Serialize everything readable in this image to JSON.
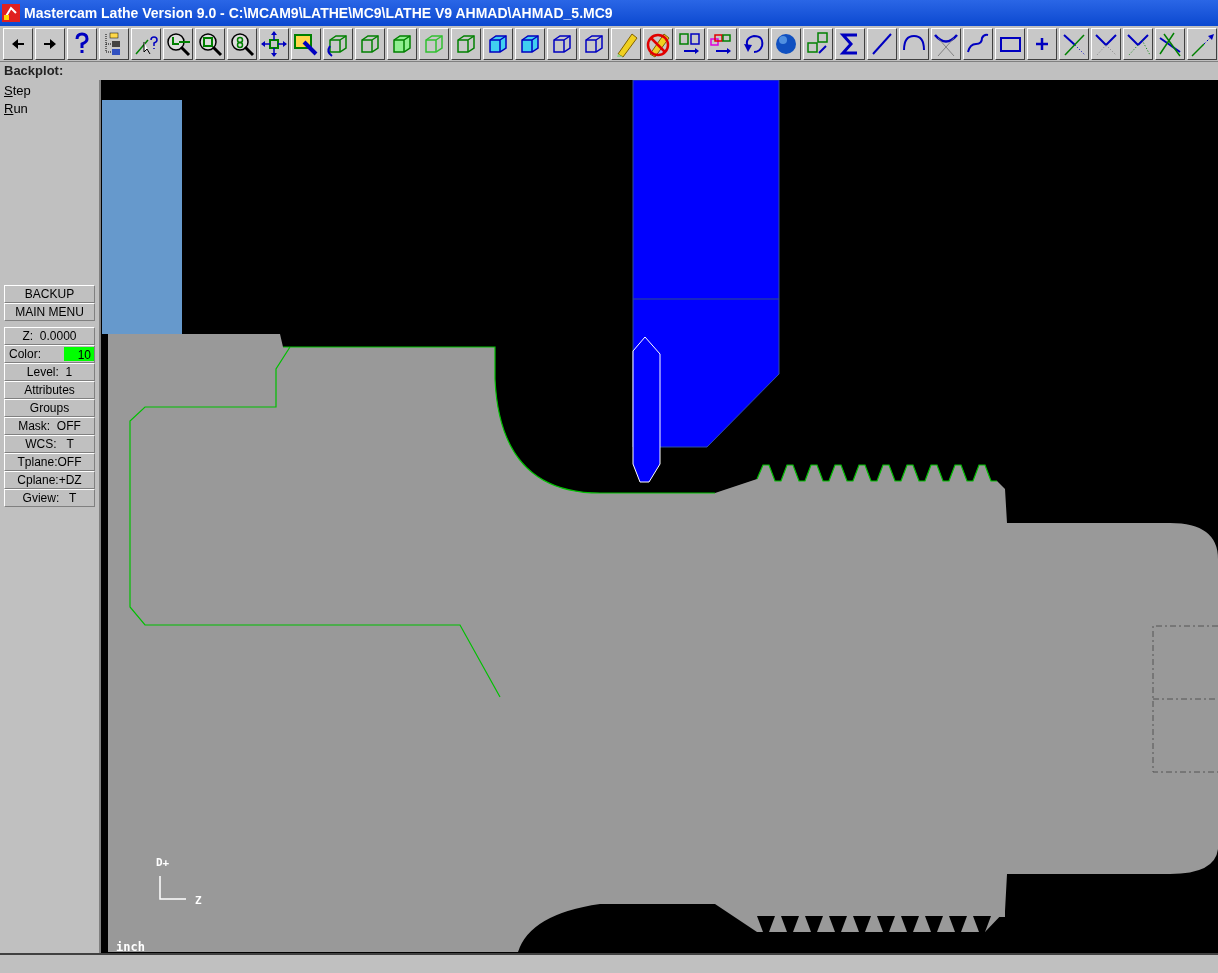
{
  "window": {
    "title": "Mastercam Lathe Version 9.0 - C:\\MCAM9\\LATHE\\MC9\\LATHE V9 AHMAD\\AHMAD_5.MC9"
  },
  "prompt": "Backplot:",
  "menu": [
    {
      "label": "Step"
    },
    {
      "label": "Run"
    }
  ],
  "buttons": [
    "BACKUP",
    "MAIN MENU"
  ],
  "status_items": [
    {
      "kind": "text",
      "label": "Z:  0.0000"
    },
    {
      "kind": "color",
      "label": "Color:",
      "value": "10",
      "color": "#00ff00"
    },
    {
      "kind": "text",
      "label": "Level:  1"
    },
    {
      "kind": "text",
      "label": "Attributes"
    },
    {
      "kind": "text",
      "label": "Groups"
    },
    {
      "kind": "text",
      "label": "Mask:  OFF"
    },
    {
      "kind": "text",
      "label": "WCS:   T"
    },
    {
      "kind": "text",
      "label": "Tplane:OFF"
    },
    {
      "kind": "text",
      "label": "Cplane:+DZ"
    },
    {
      "kind": "text",
      "label": "Gview:   T"
    }
  ],
  "viewport": {
    "axis_up": "D+",
    "axis_right": "Z",
    "units": "inch"
  }
}
